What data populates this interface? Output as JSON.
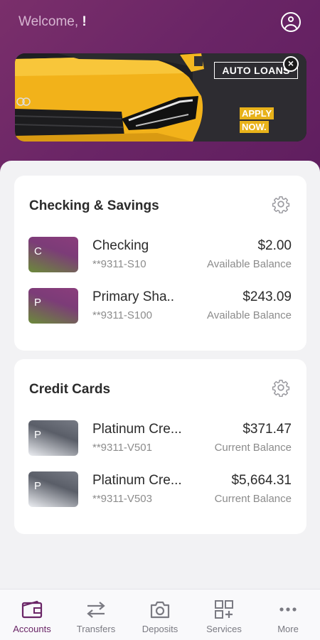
{
  "header": {
    "welcome": "Welcome,",
    "name": "!",
    "profile_icon": "user-circle-icon"
  },
  "banner": {
    "title": "AUTO LOANS",
    "apply_line1": "APPLY",
    "apply_line2": "NOW.",
    "close_glyph": "×",
    "accent": "#e8b21a"
  },
  "sections": [
    {
      "title": "Checking & Savings",
      "accounts": [
        {
          "initial": "C",
          "name": "Checking",
          "number": "**9311-S10",
          "amount": "$2.00",
          "balance_label": "Available Balance"
        },
        {
          "initial": "P",
          "name": "Primary Sha..",
          "number": "**9311-S100",
          "amount": "$243.09",
          "balance_label": "Available Balance"
        }
      ]
    },
    {
      "title": "Credit Cards",
      "accounts": [
        {
          "initial": "P",
          "name": "Platinum Cre...",
          "number": "**9311-V501",
          "amount": "$371.47",
          "balance_label": "Current Balance"
        },
        {
          "initial": "P",
          "name": "Platinum Cre...",
          "number": "**9311-V503",
          "amount": "$5,664.31",
          "balance_label": "Current Balance"
        }
      ]
    }
  ],
  "nav": [
    {
      "label": "Accounts",
      "icon": "wallet-icon",
      "active": true
    },
    {
      "label": "Transfers",
      "icon": "arrows-swap-icon",
      "active": false
    },
    {
      "label": "Deposits",
      "icon": "camera-icon",
      "active": false
    },
    {
      "label": "Services",
      "icon": "grid-plus-icon",
      "active": false
    },
    {
      "label": "More",
      "icon": "ellipsis-icon",
      "active": false
    }
  ],
  "colors": {
    "brand": "#6a2566",
    "background": "#f2f2f4"
  }
}
